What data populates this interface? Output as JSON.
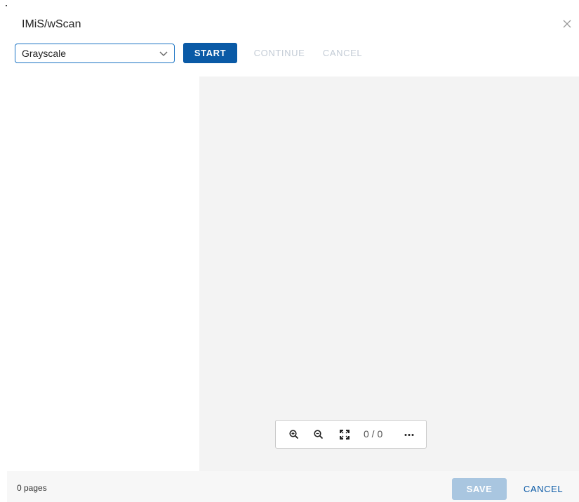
{
  "dialog": {
    "title": "IMiS/wScan",
    "close_icon": "close-icon"
  },
  "toolbar": {
    "color_mode": {
      "selected": "Grayscale",
      "icon": "chevron-down-icon"
    },
    "start_label": "START",
    "continue_label": "CONTINUE",
    "cancel_label": "CANCEL"
  },
  "viewer": {
    "zoom_in_icon": "zoom-in-icon",
    "zoom_out_icon": "zoom-out-icon",
    "fit_icon": "fit-screen-icon",
    "page_indicator": "0 / 0",
    "more_icon": "more-horizontal-icon"
  },
  "footer": {
    "pages_count": "0 pages",
    "save_label": "SAVE",
    "cancel_label": "CANCEL"
  },
  "colors": {
    "primary": "#0a5aa6",
    "primary_disabled": "#a9c6e0",
    "select_border": "#1b74c4",
    "viewer_bg": "#f3f3f3",
    "disabled_text": "#c4ccd6"
  }
}
